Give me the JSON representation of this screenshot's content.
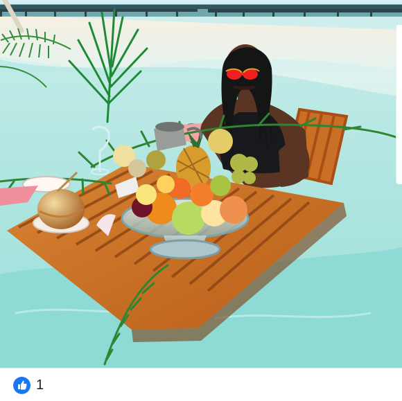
{
  "reactions": {
    "count": "1",
    "icon": "like-icon",
    "color": "#1877f2"
  },
  "photo": {
    "icon": "photo-image"
  }
}
